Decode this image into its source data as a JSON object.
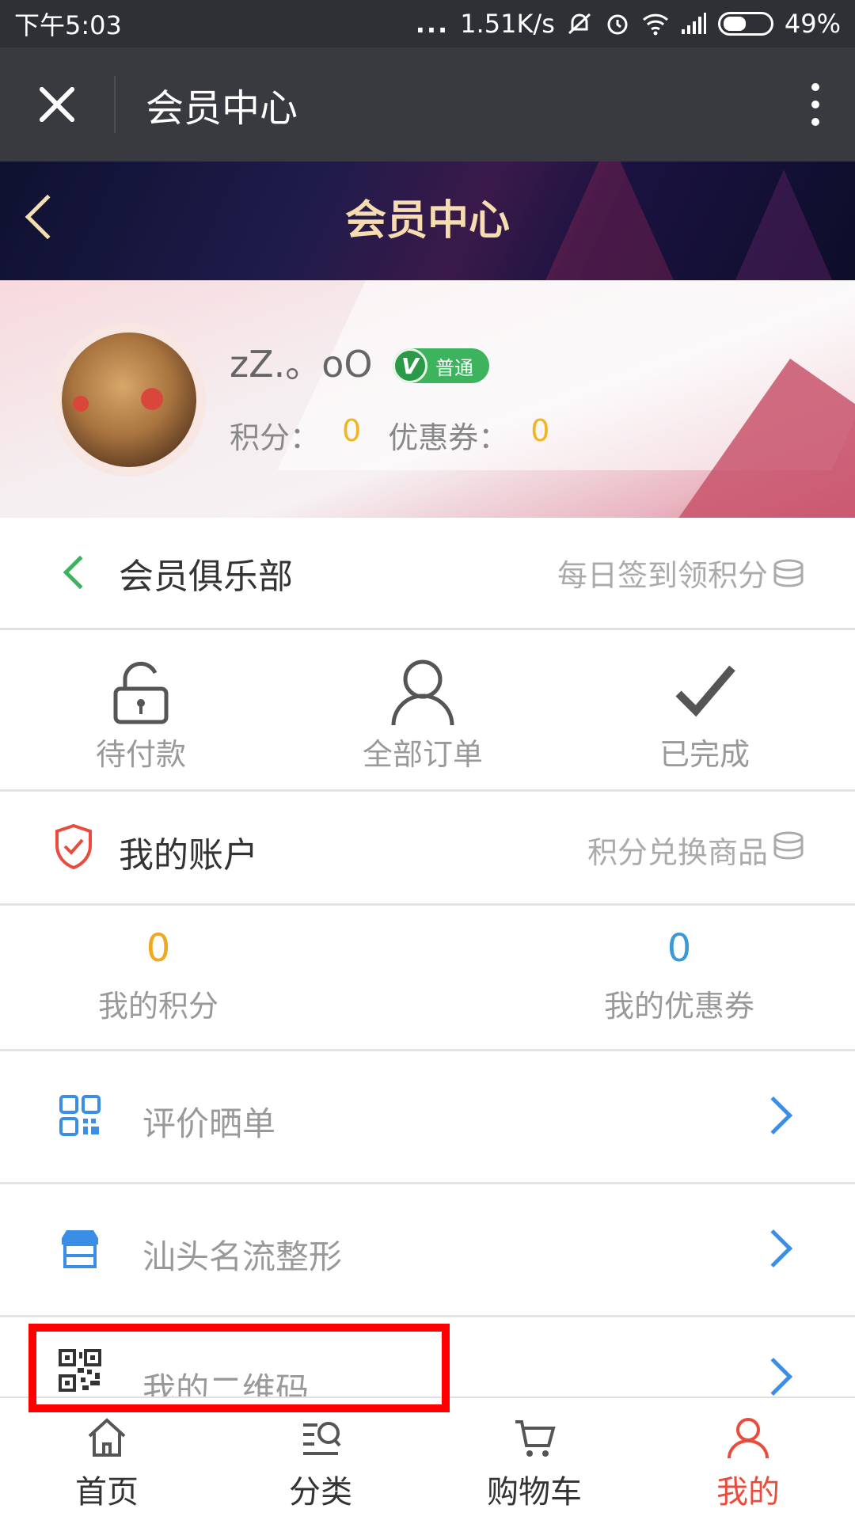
{
  "status_bar": {
    "time": "下午5:03",
    "dots": "...",
    "network_speed": "1.51K/s",
    "battery_percent": "49%"
  },
  "wechat_header": {
    "title": "会员中心"
  },
  "page_header": {
    "title": "会员中心"
  },
  "profile": {
    "username": "zZ.。oO",
    "level_badge": "普通",
    "badge_letter": "V",
    "points_label": "积分：",
    "points_value": "0",
    "coupons_label": "优惠券：",
    "coupons_value": "0"
  },
  "club": {
    "label": "会员俱乐部",
    "extra": "每日签到领积分"
  },
  "orders": [
    {
      "label": "待付款",
      "icon": "lock-icon"
    },
    {
      "label": "全部订单",
      "icon": "person-icon"
    },
    {
      "label": "已完成",
      "icon": "checkmark-icon"
    }
  ],
  "account": {
    "label": "我的账户",
    "extra": "积分兑换商品"
  },
  "balances": [
    {
      "value": "0",
      "label": "我的积分",
      "color": "#f0a81e"
    },
    {
      "value": "0",
      "label": "我的优惠券",
      "color": "#3a9ad9"
    }
  ],
  "menu": [
    {
      "label": "评价晒单",
      "icon": "grid-icon"
    },
    {
      "label": "汕头名流整形",
      "icon": "store-icon"
    },
    {
      "label": "我的二维码",
      "icon": "qrcode-icon"
    }
  ],
  "bottom_nav": [
    {
      "label": "首页",
      "icon": "home-icon"
    },
    {
      "label": "分类",
      "icon": "category-search-icon"
    },
    {
      "label": "购物车",
      "icon": "cart-icon"
    },
    {
      "label": "我的",
      "icon": "user-icon",
      "active": true
    }
  ],
  "colors": {
    "accent_green": "#3cb35c",
    "accent_blue": "#3a8ee6",
    "accent_red": "#e94b3c",
    "header_gold": "#f6dcae"
  }
}
